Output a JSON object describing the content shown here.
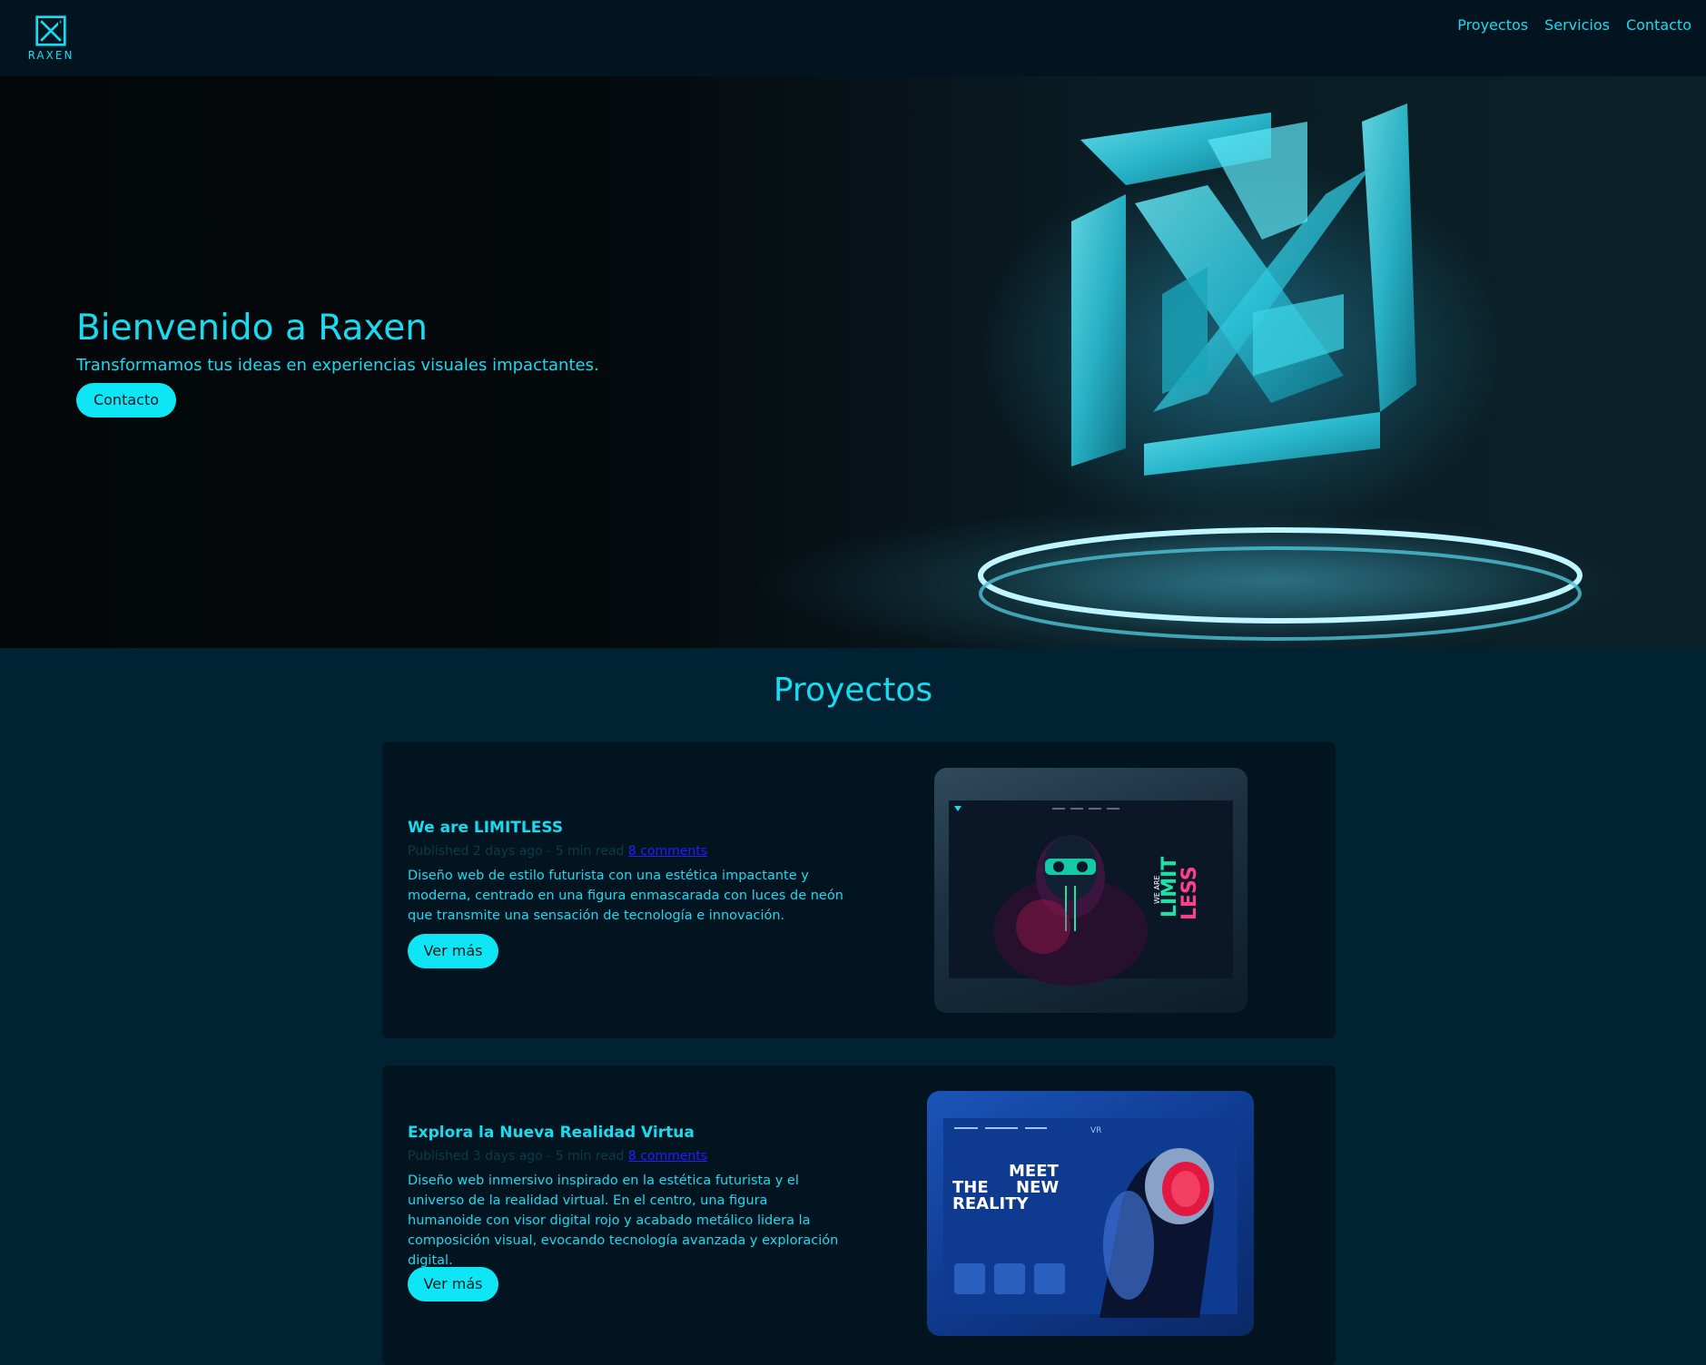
{
  "header": {
    "logo_text": "RAXEN",
    "nav": [
      {
        "label": "Proyectos"
      },
      {
        "label": "Servicios"
      },
      {
        "label": "Contacto"
      }
    ]
  },
  "hero": {
    "title": "Bienvenido a Raxen",
    "subtitle": "Transformamos tus ideas en experiencias visuales impactantes.",
    "button_label": "Contacto"
  },
  "projects": {
    "section_title": "Proyectos",
    "items": [
      {
        "title": "We are LIMITLESS",
        "meta_text": "Published 2 days ago - 5 min read ",
        "comments_link": "8 comments",
        "description": "Diseño web de estilo futurista con una estética impactante y moderna, centrado en una figura enmascarada con luces de neón que transmite una sensación de tecnología e innovación.",
        "button_label": "Ver más",
        "image_text": [
          "WE ARE",
          "LIMIT",
          "LESS"
        ]
      },
      {
        "title": "Explora la Nueva Realidad Virtua",
        "meta_text": "Published 3 days ago - 5 min read ",
        "comments_link": "8 comments",
        "description": "Diseño web inmersivo inspirado en la estética futurista y el universo de la realidad virtual. En el centro, una figura humanoide con visor digital rojo y acabado metálico lidera la composición visual, evocando tecnología avanzada y exploración digital.",
        "button_label": "Ver más",
        "image_text": [
          "MEET",
          "THE",
          "NEW",
          "REALITY",
          "VR"
        ]
      }
    ]
  },
  "colors": {
    "accent": "#19dbf0",
    "button": "#0fe6f5",
    "header_bg": "#01141f",
    "page_bg": "#012233",
    "card_bg": "#01141f"
  }
}
